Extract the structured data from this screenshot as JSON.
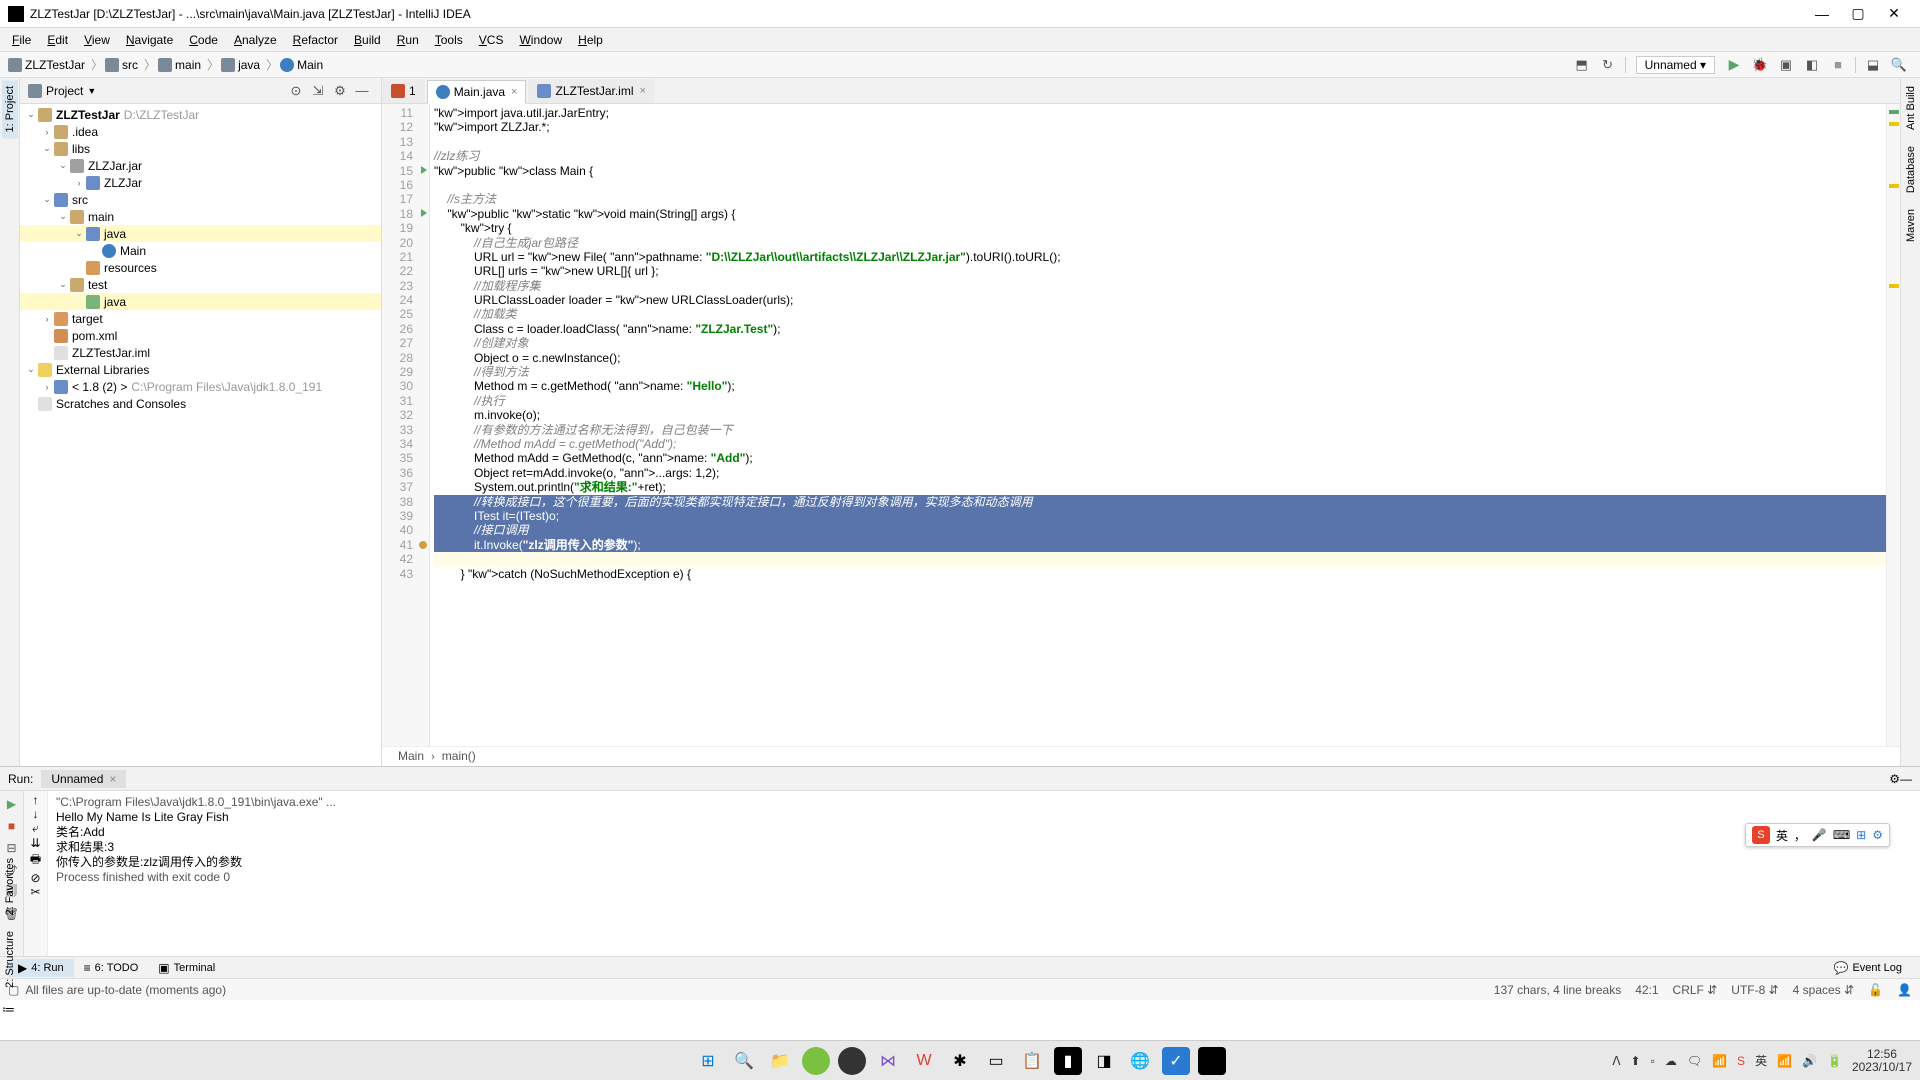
{
  "titlebar": {
    "title": "ZLZTestJar [D:\\ZLZTestJar] - ...\\src\\main\\java\\Main.java [ZLZTestJar] - IntelliJ IDEA"
  },
  "menu": [
    "File",
    "Edit",
    "View",
    "Navigate",
    "Code",
    "Analyze",
    "Refactor",
    "Build",
    "Run",
    "Tools",
    "VCS",
    "Window",
    "Help"
  ],
  "breadcrumbs": [
    {
      "label": "ZLZTestJar",
      "icon": "folder"
    },
    {
      "label": "src",
      "icon": "folder"
    },
    {
      "label": "main",
      "icon": "folder"
    },
    {
      "label": "java",
      "icon": "folder"
    },
    {
      "label": "Main",
      "icon": "class"
    }
  ],
  "runconfig": "Unnamed",
  "project": {
    "title": "Project",
    "tree": [
      {
        "d": 0,
        "tw": "v",
        "ico": "folder",
        "nm": "ZLZTestJar",
        "dim": "D:\\ZLZTestJar",
        "bold": true
      },
      {
        "d": 1,
        "tw": ">",
        "ico": "folder",
        "nm": ".idea"
      },
      {
        "d": 1,
        "tw": "v",
        "ico": "folder",
        "nm": "libs"
      },
      {
        "d": 2,
        "tw": "v",
        "ico": "jar",
        "nm": "ZLZJar.jar"
      },
      {
        "d": 3,
        "tw": ">",
        "ico": "folder-blue",
        "nm": "ZLZJar"
      },
      {
        "d": 1,
        "tw": "v",
        "ico": "folder-blue",
        "nm": "src"
      },
      {
        "d": 2,
        "tw": "v",
        "ico": "folder",
        "nm": "main"
      },
      {
        "d": 3,
        "tw": "v",
        "ico": "folder-blue",
        "nm": "java",
        "sel": true
      },
      {
        "d": 4,
        "tw": "",
        "ico": "class",
        "nm": "Main"
      },
      {
        "d": 3,
        "tw": "",
        "ico": "folder-orange",
        "nm": "resources"
      },
      {
        "d": 2,
        "tw": "v",
        "ico": "folder",
        "nm": "test"
      },
      {
        "d": 3,
        "tw": "",
        "ico": "folder-green",
        "nm": "java",
        "sel": true
      },
      {
        "d": 1,
        "tw": ">",
        "ico": "folder-orange",
        "nm": "target"
      },
      {
        "d": 1,
        "tw": "",
        "ico": "xml",
        "nm": "pom.xml"
      },
      {
        "d": 1,
        "tw": "",
        "ico": "file",
        "nm": "ZLZTestJar.iml"
      },
      {
        "d": 0,
        "tw": "v",
        "ico": "lib",
        "nm": "External Libraries"
      },
      {
        "d": 1,
        "tw": ">",
        "ico": "folder-blue",
        "nm": "< 1.8 (2) >",
        "dim": "C:\\Program Files\\Java\\jdk1.8.0_191"
      },
      {
        "d": 0,
        "tw": "",
        "ico": "file",
        "nm": "Scratches and Consoles"
      }
    ]
  },
  "tabs": [
    {
      "label": "1",
      "icon": "maven",
      "active": false,
      "pinned": true
    },
    {
      "label": "Main.java",
      "icon": "java",
      "active": true
    },
    {
      "label": "ZLZTestJar.iml",
      "icon": "iml",
      "active": false
    }
  ],
  "code": {
    "start": 11,
    "lines": [
      {
        "t": "import java.util.jar.JarEntry;",
        "cls": ""
      },
      {
        "t": "import ZLZJar.*;",
        "cls": ""
      },
      {
        "t": "",
        "cls": ""
      },
      {
        "t": "//zlz练习",
        "cls": "cm"
      },
      {
        "t": "public class Main {",
        "cls": "",
        "run": true
      },
      {
        "t": "",
        "cls": ""
      },
      {
        "t": "    //s主方法",
        "cls": "cm"
      },
      {
        "t": "    public static void main(String[] args) {",
        "cls": "",
        "run": true
      },
      {
        "t": "        try {",
        "cls": ""
      },
      {
        "t": "            //自己生成jar包路径",
        "cls": "cm"
      },
      {
        "t": "            URL url = new File( pathname: \"D:\\\\ZLZJar\\\\out\\\\artifacts\\\\ZLZJar\\\\ZLZJar.jar\").toURI().toURL();",
        "cls": ""
      },
      {
        "t": "            URL[] urls = new URL[]{ url };",
        "cls": ""
      },
      {
        "t": "            //加载程序集",
        "cls": "cm"
      },
      {
        "t": "            URLClassLoader loader = new URLClassLoader(urls);",
        "cls": ""
      },
      {
        "t": "            //加载类",
        "cls": "cm"
      },
      {
        "t": "            Class c = loader.loadClass( name: \"ZLZJar.Test\");",
        "cls": ""
      },
      {
        "t": "            //创建对象",
        "cls": "cm"
      },
      {
        "t": "            Object o = c.newInstance();",
        "cls": ""
      },
      {
        "t": "            //得到方法",
        "cls": "cm"
      },
      {
        "t": "            Method m = c.getMethod( name: \"Hello\");",
        "cls": "",
        "warn": "getMethod"
      },
      {
        "t": "            //执行",
        "cls": "cm"
      },
      {
        "t": "            m.invoke(o);",
        "cls": ""
      },
      {
        "t": "            //有参数的方法通过名称无法得到，自己包装一下",
        "cls": "cm"
      },
      {
        "t": "            //Method mAdd = c.getMethod(\"Add\");",
        "cls": "cm"
      },
      {
        "t": "            Method mAdd = GetMethod(c, name: \"Add\");",
        "cls": ""
      },
      {
        "t": "            Object ret=mAdd.invoke(o, ...args: 1,2);",
        "cls": ""
      },
      {
        "t": "            System.out.println(\"求和结果:\"+ret);",
        "cls": ""
      },
      {
        "t": "            //转换成接口，这个很重要，后面的实现类都实现特定接口，通过反射得到对象调用，实现多态和动态调用",
        "cls": "cm",
        "sel": true
      },
      {
        "t": "            ITest it=(ITest)o;",
        "cls": "",
        "sel": true
      },
      {
        "t": "            //接口调用",
        "cls": "cm",
        "sel": true
      },
      {
        "t": "            it.Invoke(\"zlz调用传入的参数\");",
        "cls": "",
        "sel": true,
        "bp": true
      },
      {
        "t": "",
        "cls": "",
        "caret": true
      },
      {
        "t": "        } catch (NoSuchMethodException e) {",
        "cls": ""
      }
    ],
    "breadcrumb": [
      "Main",
      "main()"
    ]
  },
  "lefttabs": [
    "1: Project"
  ],
  "leftbottom": [
    "2: Favorites",
    "2: Structure"
  ],
  "righttabs": [
    "Ant Build",
    "Database",
    "Maven"
  ],
  "run": {
    "label": "Run:",
    "tab": "Unnamed",
    "lines": [
      "\"C:\\Program Files\\Java\\jdk1.8.0_191\\bin\\java.exe\" ...",
      "Hello My Name Is Lite Gray Fish",
      "类名:Add",
      "求和结果:3",
      "你传入的参数是:zlz调用传入的参数",
      "",
      "Process finished with exit code 0"
    ]
  },
  "bottom": [
    {
      "label": "4: Run",
      "active": true,
      "icon": "▶"
    },
    {
      "label": "6: TODO",
      "icon": "≡"
    },
    {
      "label": "Terminal",
      "icon": "▣"
    }
  ],
  "eventlog": "Event Log",
  "status": {
    "msg": "All files are up-to-date (moments ago)",
    "sel": "137 chars, 4 line breaks",
    "pos": "42:1",
    "le": "CRLF",
    "enc": "UTF-8",
    "indent": "4 spaces"
  },
  "ime": [
    "英",
    "，",
    "🎤",
    "⌨",
    "⊞",
    "⚙"
  ],
  "clock": {
    "time": "12:56",
    "date": "2023/10/17"
  }
}
